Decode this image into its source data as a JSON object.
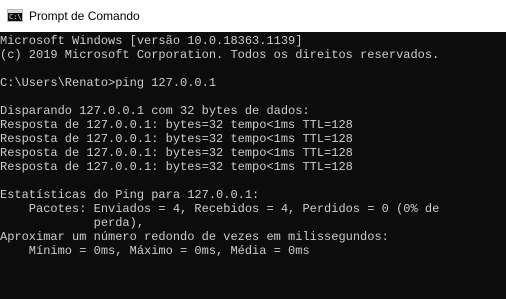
{
  "window": {
    "title": "Prompt de Comando",
    "icon": "cmd-icon",
    "icon_prompt": "C:\\"
  },
  "console": {
    "lines": [
      "Microsoft Windows [versão 10.0.18363.1139]",
      "(c) 2019 Microsoft Corporation. Todos os direitos reservados.",
      "",
      "C:\\Users\\Renato>ping 127.0.0.1",
      "",
      "Disparando 127.0.0.1 com 32 bytes de dados:",
      "Resposta de 127.0.0.1: bytes=32 tempo<1ms TTL=128",
      "Resposta de 127.0.0.1: bytes=32 tempo<1ms TTL=128",
      "Resposta de 127.0.0.1: bytes=32 tempo<1ms TTL=128",
      "Resposta de 127.0.0.1: bytes=32 tempo<1ms TTL=128",
      "",
      "Estatísticas do Ping para 127.0.0.1:",
      "    Pacotes: Enviados = 4, Recebidos = 4, Perdidos = 0 (0% de",
      "             perda),",
      "Aproximar um número redondo de vezes em milissegundos:",
      "    Mínimo = 0ms, Máximo = 0ms, Média = 0ms"
    ],
    "colors": {
      "background": "#0c0c0c",
      "foreground": "#cccccc"
    }
  }
}
